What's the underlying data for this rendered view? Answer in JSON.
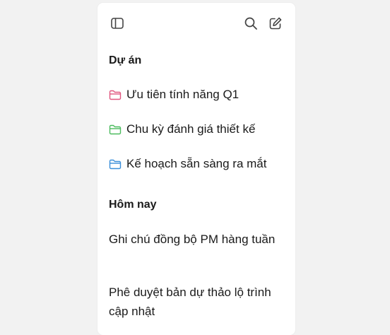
{
  "toolbar": {
    "sidebar_toggle_icon": "sidebar-toggle-icon",
    "search_icon": "search-icon",
    "compose_icon": "compose-icon"
  },
  "projects": {
    "title": "Dự án",
    "items": [
      {
        "label": "Ưu tiên tính năng Q1",
        "icon": "folder-icon",
        "color": "#e0567f"
      },
      {
        "label": "Chu kỳ đánh giá thiết kế",
        "icon": "folder-icon",
        "color": "#4cbb5e"
      },
      {
        "label": "Kế hoạch sẵn sàng ra mắt",
        "icon": "folder-icon",
        "color": "#3b8fd9"
      }
    ]
  },
  "today": {
    "title": "Hôm nay",
    "items": [
      {
        "label": "Ghi chú đồng bộ PM hàng tuần"
      },
      {
        "label": "Phê duyệt bản dự thảo lộ trình cập nhật"
      }
    ]
  }
}
